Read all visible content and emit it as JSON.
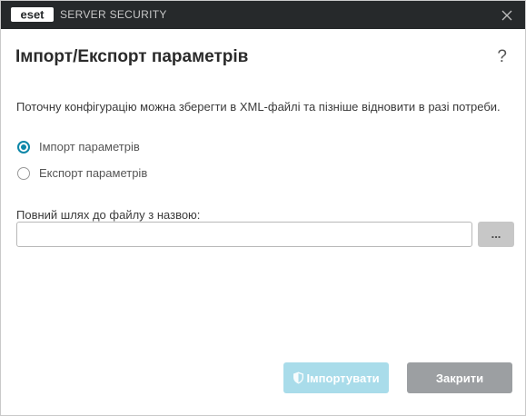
{
  "titlebar": {
    "logo_icon": "eset-logo-icon",
    "product_name": "SERVER SECURITY",
    "close_icon": "close-icon"
  },
  "dialog": {
    "title": "Імпорт/Експорт параметрів",
    "help": "?",
    "description": "Поточну конфігурацію можна зберегти в XML-файлі та пізніше відновити в разі потреби."
  },
  "options": {
    "import_label": "Імпорт параметрів",
    "export_label": "Експорт параметрів",
    "selected": "import"
  },
  "path": {
    "label": "Повний шлях до файлу з назвою:",
    "value": "",
    "browse_label": "..."
  },
  "buttons": {
    "import_label": "Імпортувати",
    "import_icon": "shield-icon",
    "close_label": "Закрити"
  },
  "colors": {
    "titlebar_bg": "#26292b",
    "accent": "#0d87a8",
    "import_disabled_bg": "#a9dcea",
    "close_bg": "#9c9fa2"
  }
}
